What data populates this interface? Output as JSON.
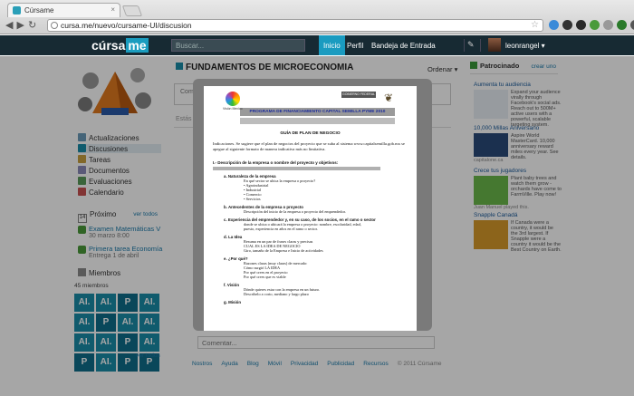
{
  "browser": {
    "tab_title": "Cúrsame",
    "url": "cursa.me/nuevo/cursame-UI/discusion",
    "ext_colors": [
      "#3a8ad8",
      "#333",
      "#2a2a2a",
      "#4a9a3a",
      "#999",
      "#2a7a2a",
      "#555"
    ]
  },
  "header": {
    "logo_a": "cúrsa",
    "logo_b": "me",
    "search_placeholder": "Buscar...",
    "nav": [
      "Inicio",
      "Perfil",
      "Bandeja de Entrada"
    ],
    "username": "leonrangel ▾",
    "accent": "#1a9bc0"
  },
  "sidebar": {
    "menu": [
      {
        "label": "Actualizaciones",
        "color": "#6a9ab8"
      },
      {
        "label": "Discusiones",
        "color": "#1a8ca8"
      },
      {
        "label": "Tareas",
        "color": "#c8a040"
      },
      {
        "label": "Documentos",
        "color": "#8a8ab8"
      },
      {
        "label": "Evaluaciones",
        "color": "#5a9a5a"
      },
      {
        "label": "Calendario",
        "color": "#c85050"
      }
    ],
    "proximo_label": "Próximo",
    "cal_day": "14",
    "ver_todos": "ver todos",
    "events": [
      {
        "title": "Examen Matemáticas V",
        "date": "30 marzo 8:00"
      },
      {
        "title": "Primera tarea Economía",
        "date": "Entrega 1 de abril"
      }
    ],
    "miembros_label": "Miembros",
    "miembros_count": "45 miembros",
    "member_tiles": [
      "AI.",
      "AI.",
      "P",
      "AI.",
      "AI.",
      "P",
      "AI.",
      "AI.",
      "AI.",
      "AI.",
      "P",
      "AI.",
      "P",
      "AI.",
      "P",
      "P"
    ],
    "ver_todos2": "ver todos"
  },
  "main": {
    "title": "FUNDAMENTOS DE MICROECONOMIA",
    "ordenar": "Ordenar ▾",
    "composer_placeholder": "Comp",
    "estas": "Estás a",
    "comment_placeholder": "Comentar...",
    "footer": [
      "Nostros",
      "Ayuda",
      "Blog",
      "Móvil",
      "Privacidad",
      "Publicidad",
      "Recursos"
    ],
    "copyright": "© 2011 Cúrsame"
  },
  "rightcol": {
    "header": "Patrocinado",
    "create_ad": "crear uno",
    "ads": [
      {
        "title": "Aumenta tu audiencia",
        "text": "Expand your audience virally through Facebook's social ads. Reach out to 500M+ active users with a powerful, scalable targeting system.",
        "img": "#e8eef4"
      },
      {
        "title": "10,000 Millas Aniversario",
        "sub": "capitalone.ca",
        "text": "Aspire World MasterCard. 10,000 anniversary reward miles every year. See details.",
        "img": "#2a4a7a"
      },
      {
        "title": "Crece tus jugadores",
        "text": "Plant baby trees and watch them grow - orchards have come to FarmVille. Play now!",
        "sub2": "Juan Manuel played this.",
        "img": "#6ab84a"
      },
      {
        "title": "Snapple Canadá",
        "text": "If Canada were a country, it would be the 3rd largest. If Snapple were a country it would be the Best Country on Earth.",
        "img": "#d89a2a"
      }
    ]
  },
  "document": {
    "sello": "GOBIERNO FEDERAL",
    "logo_caption": "Visión Mexico",
    "program": "PROGRAMA DE FINANCIAMIENTO CAPITAL SEMILLA PYME 2010",
    "guide": "GUÍA DE PLAN DE NEGOCIO",
    "indications": "Indicaciones. Se sugiere que el plan de negocios del proyecto que se suba al sistema www.capitalsemilla.gob.mx se apegue al siguiente formato de manera indicativa más no limitativa.",
    "section1": "I.- Descripción de la empresa o nombre del proyecto y objetivos:",
    "items": [
      {
        "head": "a.  Naturaleza de la empresa",
        "lines": [
          "En qué sector se ubica la empresa o proyecto?",
          "•  Agroindustrial",
          "•  Industrial",
          "•  Comercio",
          "•  Servicios"
        ]
      },
      {
        "head": "b.  Antecedentes de la empresa o proyecto",
        "lines": [
          "Descripción del inicio de la empresa o proyecto del emprendedor."
        ]
      },
      {
        "head": "c.  Experiencia del emprendedor y, en su caso, de los socios, en el ramo o sector",
        "lines": [
          "donde se ubica o ubicará la empresa o proyecto: nombre, escolaridad, edad,",
          "puesto, experiencia en años en el ramo o sector."
        ]
      },
      {
        "head": "d.  La Idea",
        "lines": [
          "Resuma en un par de frases claras y precisas",
          "CUAL ES LA IDEA DE NEGOCIO",
          "Giro, tamaño de la Empresa e Inicio de actividades"
        ]
      },
      {
        "head": "e.  ¿Por qué?",
        "lines": [
          "Razones claras (muy claras) de mercado:",
          "Cómo surgió LA IDEA",
          "Por qué crees en el proyecto",
          "Por qué crees que es viable"
        ]
      },
      {
        "head": "f.   Visión",
        "lines": [
          "Dónde quieres estar con la empresa en un futuro.",
          "Describelo a corto, mediano y largo plazo"
        ]
      },
      {
        "head": "g.  Misión",
        "lines": []
      }
    ]
  }
}
